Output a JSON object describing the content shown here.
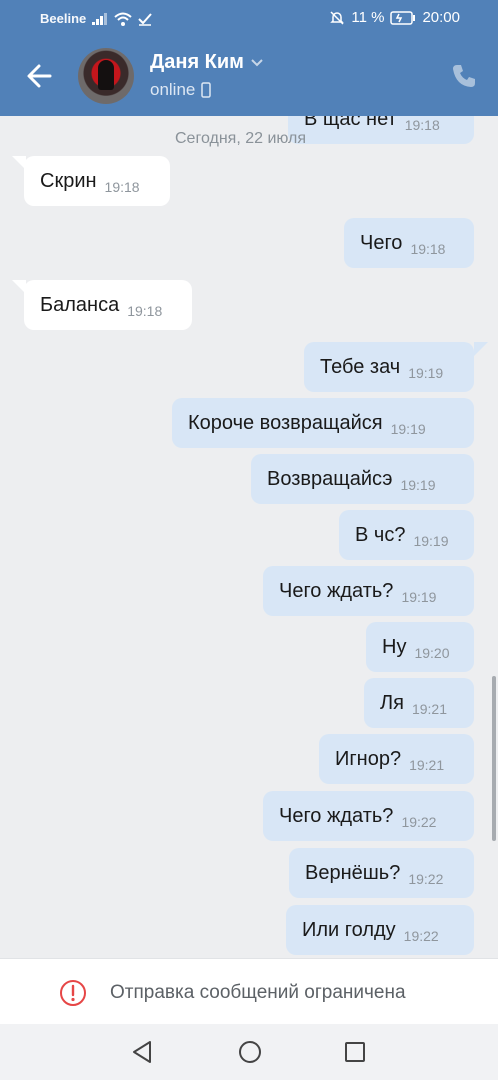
{
  "status_bar": {
    "carrier": "Beeline",
    "battery_percent": "11 %",
    "time": "20:00"
  },
  "header": {
    "contact_name": "Даня Ким",
    "contact_status": "online"
  },
  "chat": {
    "date_separator": "Сегодня, 22 июля",
    "partial_message": {
      "text": "В щас нет",
      "time": "19:18"
    },
    "messages": [
      {
        "direction": "in",
        "text": "Скрин",
        "time": "19:18"
      },
      {
        "direction": "out",
        "text": "Чего",
        "time": "19:18"
      },
      {
        "direction": "in",
        "text": "Баланса",
        "time": "19:18"
      },
      {
        "direction": "out",
        "text": "Тебе зач",
        "time": "19:19"
      },
      {
        "direction": "out",
        "text": "Короче возвращайся",
        "time": "19:19"
      },
      {
        "direction": "out",
        "text": "Возвращайсэ",
        "time": "19:19"
      },
      {
        "direction": "out",
        "text": "В чс?",
        "time": "19:19"
      },
      {
        "direction": "out",
        "text": "Чего ждать?",
        "time": "19:19"
      },
      {
        "direction": "out",
        "text": "Ну",
        "time": "19:20"
      },
      {
        "direction": "out",
        "text": "Ля",
        "time": "19:21"
      },
      {
        "direction": "out",
        "text": "Игнор?",
        "time": "19:21"
      },
      {
        "direction": "out",
        "text": "Чего ждать?",
        "time": "19:22"
      },
      {
        "direction": "out",
        "text": "Вернёшь?",
        "time": "19:22"
      },
      {
        "direction": "out",
        "text": "Или голду",
        "time": "19:22"
      }
    ]
  },
  "restriction": {
    "text": "Отправка сообщений ограничена"
  },
  "icons": {
    "back": "arrow-left-icon",
    "phone": "phone-icon",
    "warning": "exclamation-circle-icon",
    "nav_back": "triangle-back-icon",
    "nav_home": "circle-home-icon",
    "nav_recent": "square-recent-icon"
  },
  "colors": {
    "header": "#5181b8",
    "outgoing_bubble": "#d8e6f6",
    "incoming_bubble": "#ffffff",
    "warning": "#e64646"
  }
}
